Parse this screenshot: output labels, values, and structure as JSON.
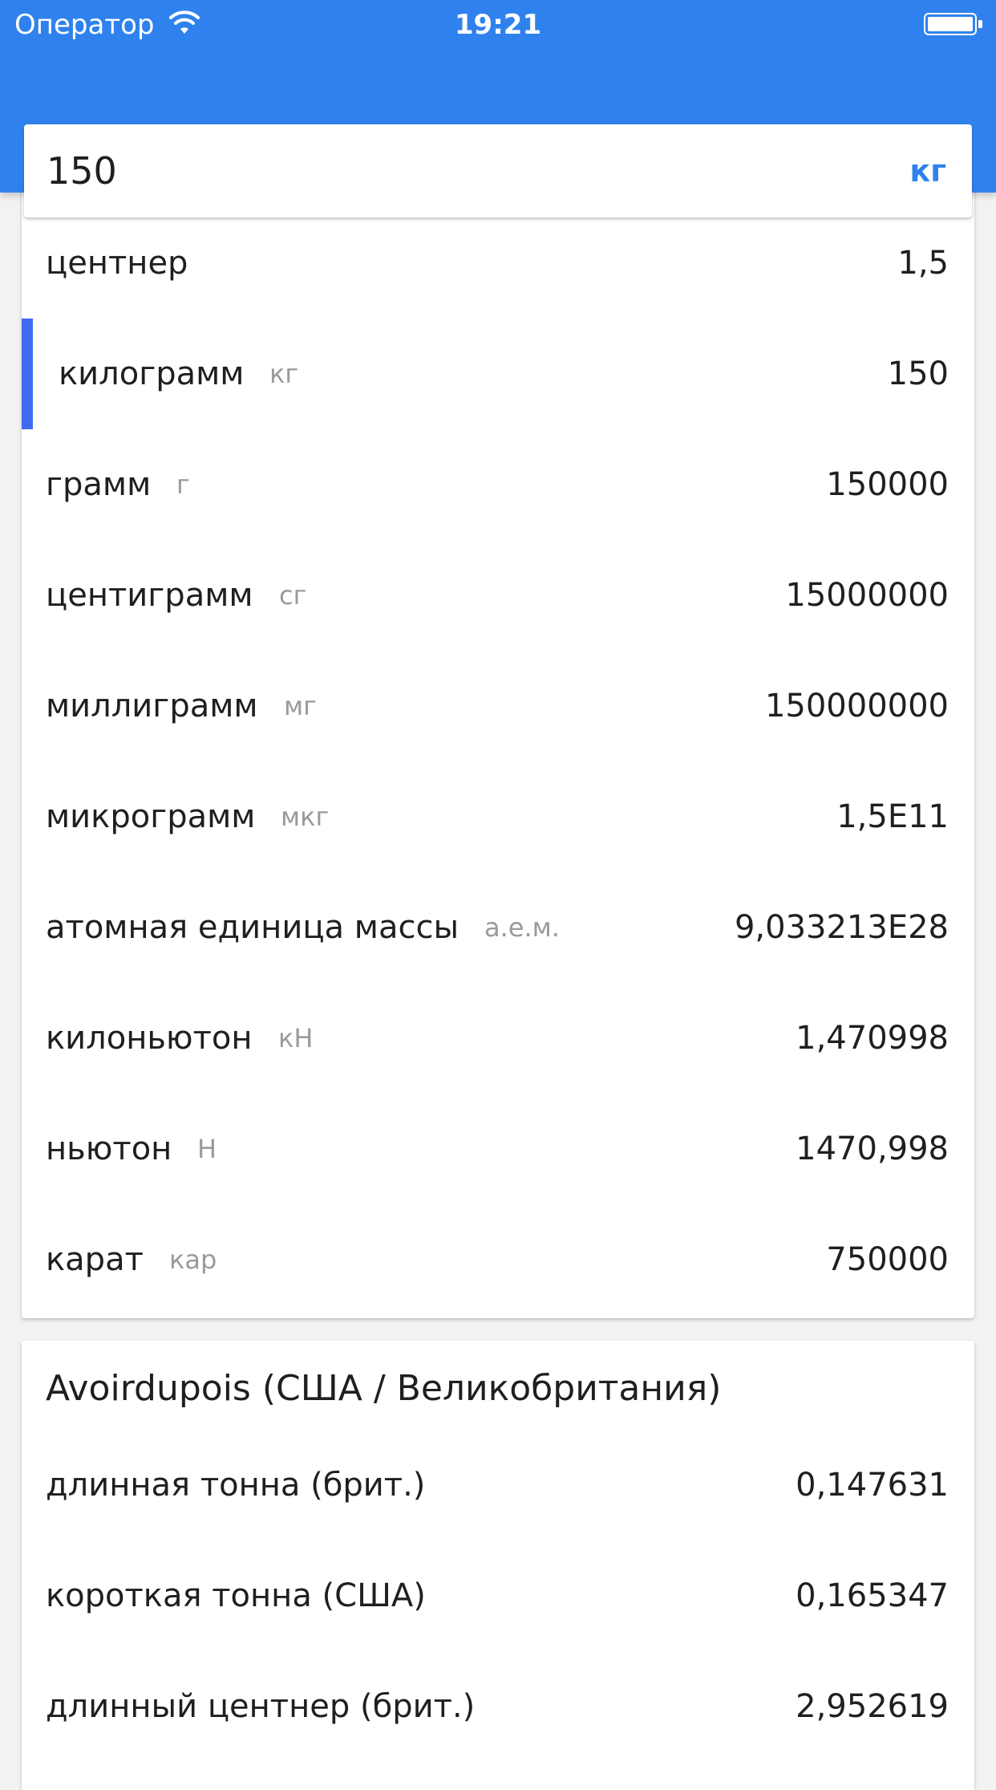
{
  "status_bar": {
    "carrier": "Оператор",
    "time": "19:21",
    "wifi_icon": "wifi-icon",
    "battery_icon": "battery-icon"
  },
  "search": {
    "value": "150",
    "unit_label": "кг"
  },
  "metric": {
    "rows": [
      {
        "name": "центнер",
        "abbr": "",
        "value": "1,5",
        "selected": false
      },
      {
        "name": "килограмм",
        "abbr": "кг",
        "value": "150",
        "selected": true
      },
      {
        "name": "грамм",
        "abbr": "г",
        "value": "150000",
        "selected": false
      },
      {
        "name": "центиграмм",
        "abbr": "сг",
        "value": "15000000",
        "selected": false
      },
      {
        "name": "миллиграмм",
        "abbr": "мг",
        "value": "150000000",
        "selected": false
      },
      {
        "name": "микрограмм",
        "abbr": "мкг",
        "value": "1,5E11",
        "selected": false
      },
      {
        "name": "атомная единица массы",
        "abbr": "а.е.м.",
        "value": "9,033213E28",
        "selected": false
      },
      {
        "name": "килоньютон",
        "abbr": "кН",
        "value": "1,470998",
        "selected": false
      },
      {
        "name": "ньютон",
        "abbr": "Н",
        "value": "1470,998",
        "selected": false
      },
      {
        "name": "карат",
        "abbr": "кар",
        "value": "750000",
        "selected": false
      }
    ]
  },
  "avoirdupois": {
    "title": "Avoirdupois (США / Великобритания)",
    "rows": [
      {
        "name": "длинная тонна (брит.)",
        "abbr": "",
        "value": "0,147631"
      },
      {
        "name": "короткая тонна (США)",
        "abbr": "",
        "value": "0,165347"
      },
      {
        "name": "длинный центнер (брит.)",
        "abbr": "",
        "value": "2,952619"
      }
    ]
  },
  "colors": {
    "accent": "#2f82ed",
    "selected_marker": "#3f6bf0",
    "abbr_text": "#9a9a9a"
  }
}
